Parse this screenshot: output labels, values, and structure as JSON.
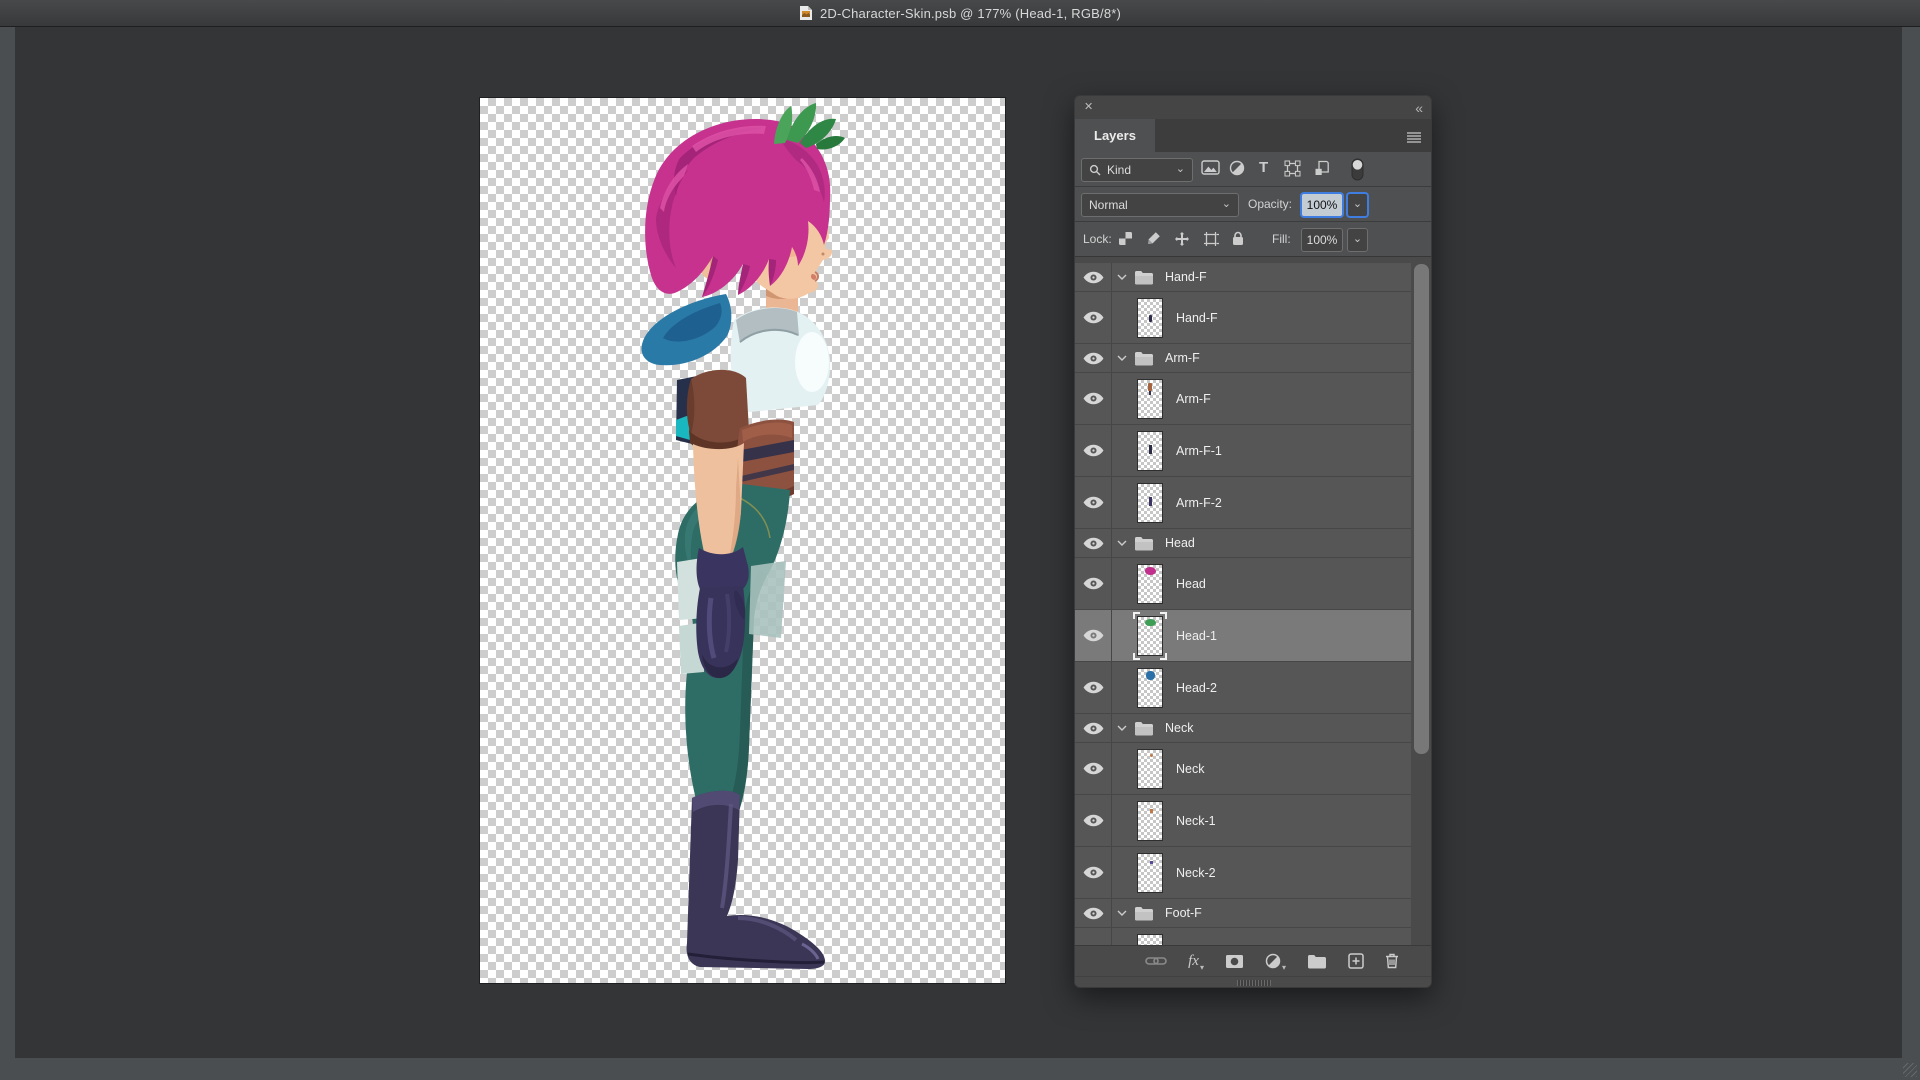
{
  "window": {
    "title": "2D-Character-Skin.psb @ 177% (Head-1, RGB/8*)"
  },
  "icons": {
    "close": "✕",
    "collapse": "«",
    "dropdown_chevron": "⌄",
    "type_filter_glyph": "T",
    "registry": [
      "document-icon",
      "close-icon",
      "collapse-panel-icon",
      "panel-menu-icon",
      "search-icon",
      "pixel-layer-filter-icon",
      "adjustment-layer-filter-icon",
      "type-layer-filter-icon",
      "shape-layer-filter-icon",
      "smart-object-filter-icon",
      "filter-toggle",
      "eye-icon",
      "folder-icon",
      "chevron-down-icon",
      "link-icon",
      "fx-icon",
      "layer-mask-icon",
      "adjustment-icon",
      "new-group-icon",
      "new-layer-icon",
      "trash-icon"
    ]
  },
  "colors": {
    "accent_blue": "#3f7de0",
    "selected_row": "#7a7a7a",
    "row_bg": "#565656",
    "panel_chrome": "#4a4a4a",
    "pasteboard": "#333537",
    "window_frame": "#4b4e50"
  },
  "canvas": {
    "zoom": "177%",
    "palette": {
      "hair_pink": "#c6328e",
      "hair_blue": "#2a7aa8",
      "leaves_green": "#3d9850",
      "skin": "#f3c7a3",
      "shirt": "#e3f1f3",
      "sleeve_brown": "#7d4a39",
      "belt_brown": "#8d5140",
      "pants_teal": "#2e6c66",
      "boot_purple": "#3c3656",
      "glove_navy": "#38335a"
    }
  },
  "layers_panel": {
    "tab_label": "Layers",
    "filter": {
      "kind_label": "Kind"
    },
    "blend_mode": "Normal",
    "opacity_label": "Opacity:",
    "opacity_value": "100%",
    "lock_label": "Lock:",
    "fill_label": "Fill:",
    "fill_value": "100%",
    "toolbar": {
      "fx_label": "fx"
    },
    "rows": [
      {
        "type": "group",
        "name": "Hand-F",
        "expanded": true,
        "visible": true
      },
      {
        "type": "layer",
        "name": "Hand-F",
        "visible": true
      },
      {
        "type": "group",
        "name": "Arm-F",
        "expanded": true,
        "visible": true
      },
      {
        "type": "layer",
        "name": "Arm-F",
        "visible": true
      },
      {
        "type": "layer",
        "name": "Arm-F-1",
        "visible": true
      },
      {
        "type": "layer",
        "name": "Arm-F-2",
        "visible": true
      },
      {
        "type": "group",
        "name": "Head",
        "expanded": true,
        "visible": true
      },
      {
        "type": "layer",
        "name": "Head",
        "visible": true
      },
      {
        "type": "layer",
        "name": "Head-1",
        "visible": true,
        "selected": true
      },
      {
        "type": "layer",
        "name": "Head-2",
        "visible": true
      },
      {
        "type": "group",
        "name": "Neck",
        "expanded": true,
        "visible": true
      },
      {
        "type": "layer",
        "name": "Neck",
        "visible": true
      },
      {
        "type": "layer",
        "name": "Neck-1",
        "visible": true
      },
      {
        "type": "layer",
        "name": "Neck-2",
        "visible": true
      },
      {
        "type": "group",
        "name": "Foot-F",
        "expanded": true,
        "visible": true
      },
      {
        "type": "layer",
        "name": "",
        "partial": true
      }
    ]
  }
}
